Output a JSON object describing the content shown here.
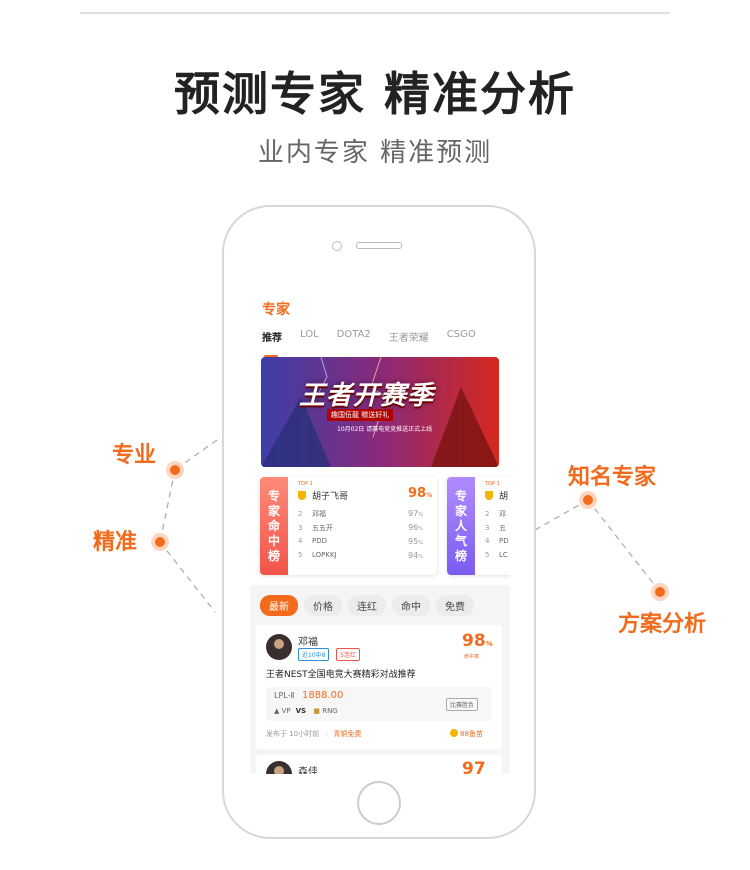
{
  "hero": {
    "title": "预测专家  精准分析",
    "subtitle": "业内专家  精准预测"
  },
  "labels": {
    "left_top": "专业",
    "left_bottom": "精准",
    "right_top": "知名专家",
    "right_bottom": "方案分析"
  },
  "app": {
    "title": "专家",
    "tabs": [
      "推荐",
      "LOL",
      "DOTA2",
      "王者荣耀",
      "CSGO"
    ],
    "banner": {
      "title": "王者开赛季",
      "line1": "趣国伍龍 赠送好礼",
      "line2": "10月02日 请赛电竞竞推送正式上线"
    },
    "rank_hit": {
      "side": "专家命中榜",
      "top_tag": "TOP 1",
      "rows": [
        {
          "rank": "",
          "name": "胡子飞哥",
          "pct": "98",
          "unit": "%"
        },
        {
          "rank": "2",
          "name": "邓福",
          "pct": "97",
          "unit": "%"
        },
        {
          "rank": "3",
          "name": "五五开",
          "pct": "96",
          "unit": "%"
        },
        {
          "rank": "4",
          "name": "PDD",
          "pct": "95",
          "unit": "%"
        },
        {
          "rank": "5",
          "name": "LOPKKJ",
          "pct": "94",
          "unit": "%"
        }
      ]
    },
    "rank_pop": {
      "side": "专家人气榜",
      "top_tag": "TOP 1",
      "rows": [
        {
          "rank": "",
          "name": "胡"
        },
        {
          "rank": "2",
          "name": "邓"
        },
        {
          "rank": "3",
          "name": "五"
        },
        {
          "rank": "4",
          "name": "PD"
        },
        {
          "rank": "5",
          "name": "LC"
        }
      ]
    },
    "filters": [
      "最新",
      "价格",
      "连红",
      "命中",
      "免费"
    ],
    "post": {
      "name": "邓福",
      "badge1": "近10中8",
      "badge2": "5连红",
      "hit": "98",
      "hit_unit": "%",
      "hit_label": "命中率",
      "title": "王者NEST全国电竞大赛精彩对战推荐",
      "league": "LPL-Ⅱ",
      "price": "1888.00",
      "team1": "VP",
      "vs": "VS",
      "team2": "RNG",
      "tag": "比赛胜负",
      "time": "发布于 10小时前",
      "free": "青铜免费",
      "coins": "88鱼苗"
    },
    "post2": {
      "name": "森佳",
      "hit": "97"
    }
  },
  "colors": {
    "accent": "#f26b1d"
  }
}
